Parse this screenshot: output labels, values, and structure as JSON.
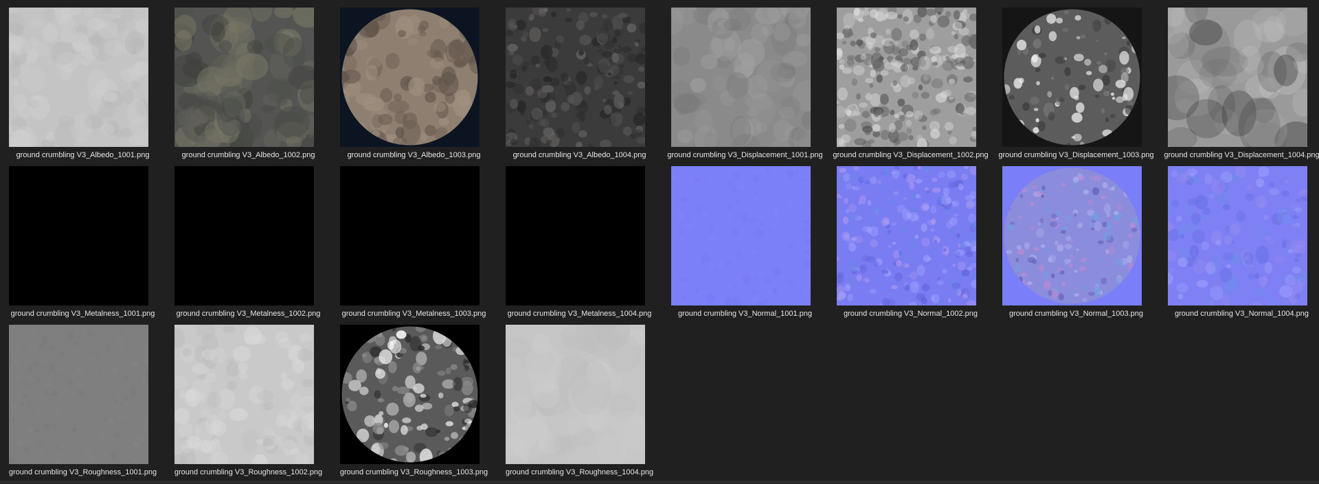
{
  "files": [
    {
      "name": "ground crumbling V3_Albedo_1001.png",
      "thumb": "albedo-light-thumbnail"
    },
    {
      "name": "ground crumbling V3_Albedo_1002.png",
      "thumb": "albedo-dark-mottled-thumbnail"
    },
    {
      "name": "ground crumbling V3_Albedo_1003.png",
      "thumb": "albedo-rock-disc-thumbnail"
    },
    {
      "name": "ground crumbling V3_Albedo_1004.png",
      "thumb": "albedo-speckled-dark-thumbnail"
    },
    {
      "name": "ground crumbling V3_Displacement_1001.png",
      "thumb": "displacement-soft-gray-thumbnail"
    },
    {
      "name": "ground crumbling V3_Displacement_1002.png",
      "thumb": "displacement-bumpy-thumbnail"
    },
    {
      "name": "ground crumbling V3_Displacement_1003.png",
      "thumb": "displacement-disc-thumbnail"
    },
    {
      "name": "ground crumbling V3_Displacement_1004.png",
      "thumb": "displacement-cloudy-thumbnail"
    },
    {
      "name": "ground crumbling V3_Metalness_1001.png",
      "thumb": "metalness-black-thumbnail"
    },
    {
      "name": "ground crumbling V3_Metalness_1002.png",
      "thumb": "metalness-black-thumbnail"
    },
    {
      "name": "ground crumbling V3_Metalness_1003.png",
      "thumb": "metalness-black-thumbnail"
    },
    {
      "name": "ground crumbling V3_Metalness_1004.png",
      "thumb": "metalness-black-thumbnail"
    },
    {
      "name": "ground crumbling V3_Normal_1001.png",
      "thumb": "normal-flat-thumbnail"
    },
    {
      "name": "ground crumbling V3_Normal_1002.png",
      "thumb": "normal-detailed-thumbnail"
    },
    {
      "name": "ground crumbling V3_Normal_1003.png",
      "thumb": "normal-disc-thumbnail"
    },
    {
      "name": "ground crumbling V3_Normal_1004.png",
      "thumb": "normal-streaked-thumbnail"
    },
    {
      "name": "ground crumbling V3_Roughness_1001.png",
      "thumb": "roughness-mid-gray-thumbnail"
    },
    {
      "name": "ground crumbling V3_Roughness_1002.png",
      "thumb": "roughness-light-thumbnail"
    },
    {
      "name": "ground crumbling V3_Roughness_1003.png",
      "thumb": "roughness-disc-thumbnail"
    },
    {
      "name": "ground crumbling V3_Roughness_1004.png",
      "thumb": "roughness-pale-thumbnail"
    }
  ],
  "colors": {
    "background": "#202020",
    "caption_text": "#e6e6e6",
    "normal_map_base": "#7a7ef8"
  }
}
